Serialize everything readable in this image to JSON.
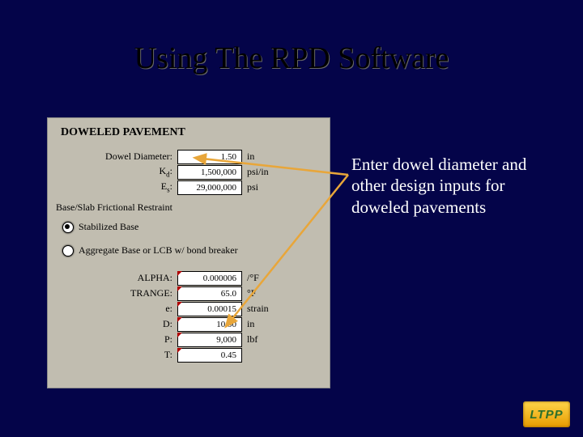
{
  "title": "Using The RPD Software",
  "panel_header": "DOWELED PAVEMENT",
  "fields_top": [
    {
      "label": "Dowel Diameter:",
      "value": "1.50",
      "unit": "in"
    },
    {
      "label": "Kₔ:",
      "value": "1,500,000",
      "unit": "psi/in",
      "label_plain": "Kd:"
    },
    {
      "label": "Eₛ:",
      "value": "29,000,000",
      "unit": "psi",
      "label_plain": "Es:"
    }
  ],
  "friction_section": "Base/Slab Frictional Restraint",
  "radio_options": [
    {
      "label": "Stabilized Base",
      "selected": true
    },
    {
      "label": "Aggregate Base or LCB w/ bond breaker",
      "selected": false
    }
  ],
  "fields_bottom": [
    {
      "label": "ALPHA:",
      "value": "0.000006",
      "unit": "/°F"
    },
    {
      "label": "TRANGE:",
      "value": "65.0",
      "unit": "°F"
    },
    {
      "label": "e:",
      "value": "0.00015",
      "unit": "strain"
    },
    {
      "label": "D:",
      "value": "10.00",
      "unit": "in"
    },
    {
      "label": "P:",
      "value": "9,000",
      "unit": "lbf"
    },
    {
      "label": "T:",
      "value": "0.45",
      "unit": ""
    }
  ],
  "annotation": "Enter dowel diameter and other design inputs for doweled pavements",
  "logo_text": "LTPP"
}
